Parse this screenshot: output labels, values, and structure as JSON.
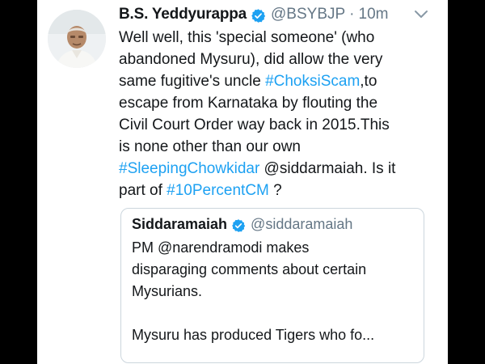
{
  "tweet": {
    "author_name": "B.S. Yeddyurappa",
    "author_handle": "@BSYBJP",
    "separator": "·",
    "time": "10m",
    "lines": [
      [
        {
          "t": "Well well, this 'special someone' (who"
        }
      ],
      [
        {
          "t": "abandoned Mysuru), did allow the very"
        }
      ],
      [
        {
          "t": "same fugitive's uncle "
        },
        {
          "t": "#ChoksiScam",
          "link": true
        },
        {
          "t": ",to"
        }
      ],
      [
        {
          "t": "escape from Karnataka by flouting the"
        }
      ],
      [
        {
          "t": "Civil Court Order way back in 2015.This"
        }
      ],
      [
        {
          "t": "is none other than our own"
        }
      ],
      [
        {
          "t": "#SleepingChowkidar",
          "link": true
        },
        {
          "t": " @siddarmaiah. Is it"
        }
      ],
      [
        {
          "t": "part of "
        },
        {
          "t": "#10PercentCM",
          "link": true
        },
        {
          "t": " ?"
        }
      ]
    ]
  },
  "quoted": {
    "author_name": "Siddaramaiah",
    "author_handle": "@siddaramaiah",
    "lines": [
      "PM @narendramodi makes",
      "disparaging comments about certain",
      "Mysurians.",
      "",
      "Mysuru has produced Tigers who fo..."
    ]
  },
  "icons": {
    "verified": "verified-badge-icon",
    "more": "chevron-down-icon",
    "avatar": "avatar"
  },
  "colors": {
    "link": "#1da1f2",
    "text": "#14171a",
    "muted": "#657786",
    "verified": "#1da1f2",
    "background": "#000000"
  }
}
